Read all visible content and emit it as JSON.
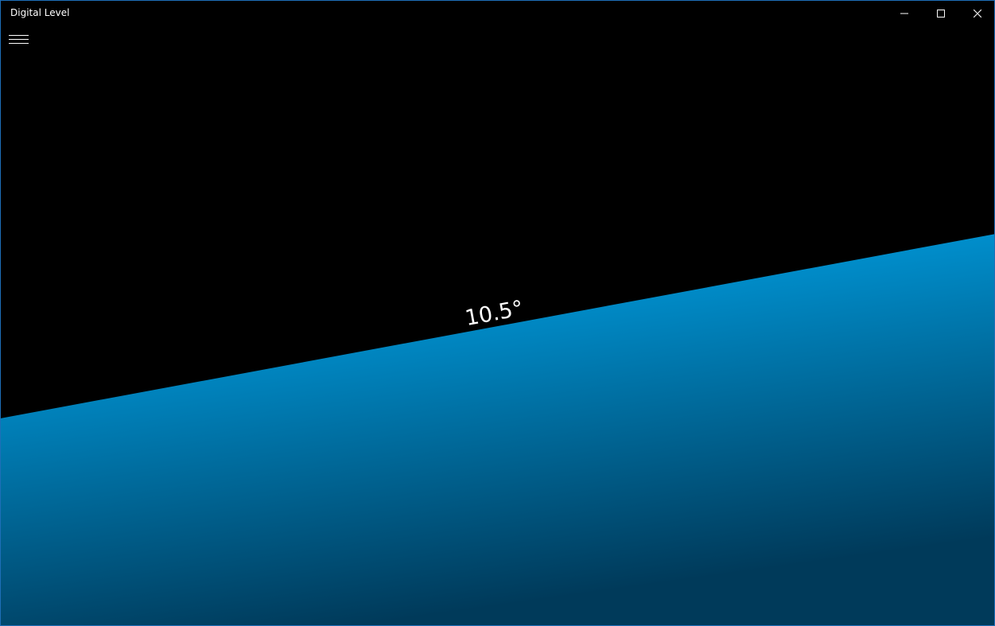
{
  "window": {
    "title": "Digital Level"
  },
  "caption_buttons": {
    "minimize_icon": "minimize-icon",
    "maximize_icon": "maximize-icon",
    "close_icon": "close-icon"
  },
  "menu": {
    "icon": "hamburger-icon"
  },
  "level": {
    "angle_degrees": 10.5,
    "angle_label": "10.5°",
    "sky_color": "#000000",
    "liquid_color_top": "#00b4ff",
    "liquid_color_bottom": "#003a5a"
  }
}
